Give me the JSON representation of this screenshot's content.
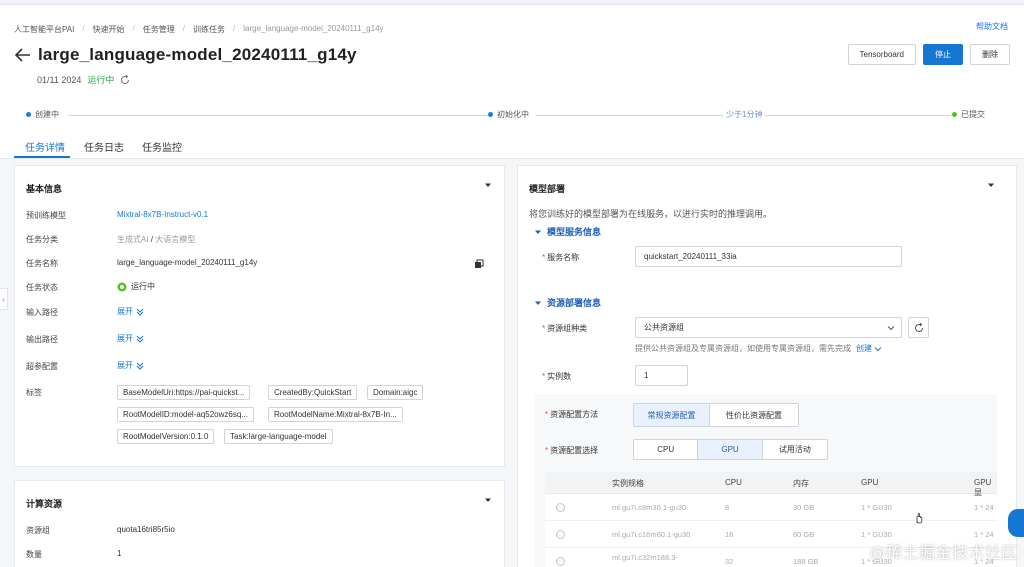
{
  "breadcrumb": {
    "items": [
      "人工智能平台PAI",
      "快速开始",
      "任务管理",
      "训练任务"
    ],
    "current": "large_language-model_20240111_g14y"
  },
  "help_link": "帮助文档",
  "title": "large_language-model_20240111_g14y",
  "meta": {
    "date": "01/11 2024",
    "status": "运行中"
  },
  "actions": {
    "tensorboard": "Tensorboard",
    "stop": "停止",
    "delete": "删除"
  },
  "timeline": {
    "created": "创建中",
    "initializing": "初始化中",
    "duration": "少于1分钟",
    "submitted": "已提交"
  },
  "tabs": [
    "任务详情",
    "任务日志",
    "任务监控"
  ],
  "basic_info": {
    "title": "基本信息",
    "rows": {
      "pretrained_model": {
        "label": "预训练模型",
        "value": "Mixtral-8x7B-Instruct-v0.1"
      },
      "category": {
        "label": "任务分类",
        "value1": "生成式AI",
        "sep": " / ",
        "value2": "大语言模型"
      },
      "name": {
        "label": "任务名称",
        "value": "large_language-model_20240111_g14y"
      },
      "status": {
        "label": "任务状态",
        "value": "运行中"
      },
      "input_path": {
        "label": "输入路径",
        "value": "展开"
      },
      "output_path": {
        "label": "输出路径",
        "value": "展开"
      },
      "hyperparams": {
        "label": "超参配置",
        "value": "展开"
      },
      "tags": {
        "label": "标签"
      }
    },
    "tags": [
      "BaseModelUri:https://pai-quickst...",
      "CreatedBy:QuickStart",
      "Domain:aigc",
      "RootModelID:model-aq52owz6sq...",
      "RootModelName:Mixtral-8x7B-In...",
      "RootModelVersion:0.1.0",
      "Task:large-language-model"
    ]
  },
  "compute": {
    "title": "计算资源",
    "resource_group": {
      "label": "资源组",
      "value": "quota16tri85r5io"
    },
    "count": {
      "label": "数量",
      "value": "1"
    }
  },
  "deploy": {
    "title": "模型部署",
    "desc": "将您训练好的模型部署为在线服务，以进行实时的推理调用。",
    "service_section": "模型服务信息",
    "service_name_label": "服务名称",
    "service_name_value": "quickstart_20240111_33ia",
    "resource_section": "资源部署信息",
    "resource_group_type_label": "资源组种类",
    "resource_group_type_value": "公共资源组",
    "resource_hint": "提供公共资源组及专属资源组，如使用专属资源组，需先完成",
    "create_link": "创建",
    "instances_label": "实例数",
    "instances_value": "1",
    "config_method_label": "资源配置方法",
    "config_methods": [
      "常规资源配置",
      "性价比资源配置"
    ],
    "config_select_label": "资源配置选择",
    "config_options": [
      "CPU",
      "GPU",
      "试用活动"
    ],
    "table": {
      "headers": [
        "实例规格",
        "CPU",
        "内存",
        "GPU",
        "GPU显"
      ],
      "rows": [
        [
          "ml.gu7i.c8m30.1-gu30",
          "8",
          "30 GB",
          "1 * GU30",
          "1 * 24"
        ],
        [
          "ml.gu7i.c16m60.1-gu30",
          "16",
          "60 GB",
          "1 * GU30",
          "1 * 24"
        ],
        [
          "ml.gu7i.c32m188.3-",
          "32",
          "188 GB",
          "1 * GU30",
          "1 * 24"
        ]
      ]
    }
  },
  "watermark": "@稀土掘金技术社区",
  "colors": {
    "accent": "#1677d2",
    "success": "#27a844",
    "danger": "#e34d59"
  }
}
